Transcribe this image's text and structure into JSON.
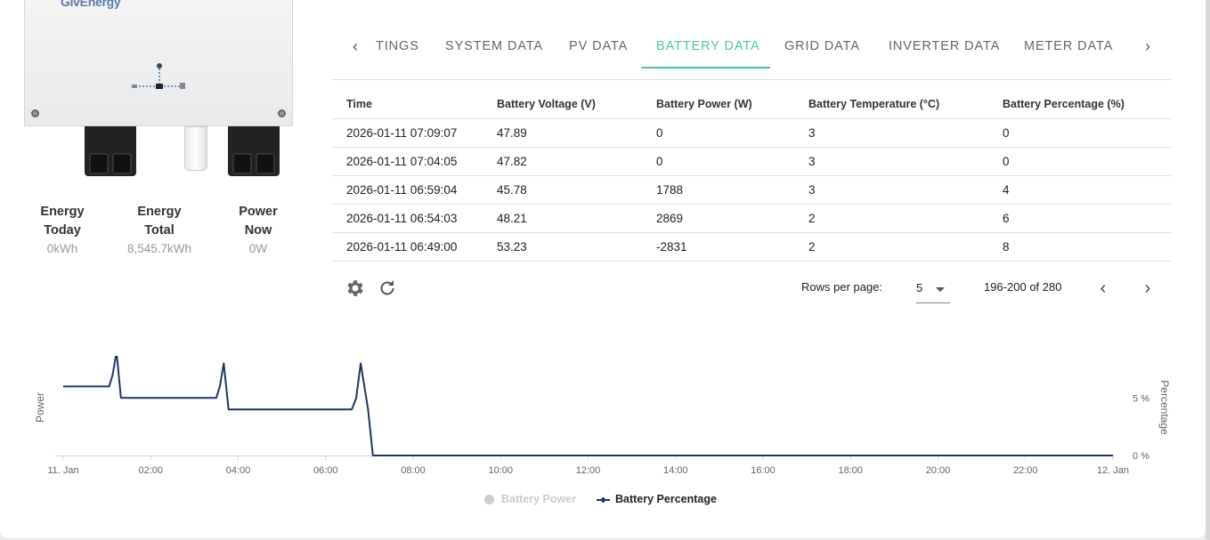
{
  "inverter": {
    "logo": "GivEnergy",
    "stats": [
      {
        "label_line1": "Energy",
        "label_line2": "Today",
        "value": "0kWh"
      },
      {
        "label_line1": "Energy",
        "label_line2": "Total",
        "value": "8,545.7kWh"
      },
      {
        "label_line1": "Power",
        "label_line2": "Now",
        "value": "0W"
      }
    ]
  },
  "tabs": {
    "items": [
      "TINGS",
      "SYSTEM DATA",
      "PV DATA",
      "BATTERY DATA",
      "GRID DATA",
      "INVERTER DATA",
      "METER DATA"
    ],
    "active": "BATTERY DATA",
    "accent": "#4fc6a2"
  },
  "table": {
    "headers": [
      "Time",
      "Battery Voltage (V)",
      "Battery Power (W)",
      "Battery Temperature (°C)",
      "Battery Percentage (%)"
    ],
    "rows": [
      [
        "2026-01-11 07:09:07",
        "47.89",
        "0",
        "3",
        "0"
      ],
      [
        "2026-01-11 07:04:05",
        "47.82",
        "0",
        "3",
        "0"
      ],
      [
        "2026-01-11 06:59:04",
        "45.78",
        "1788",
        "3",
        "4"
      ],
      [
        "2026-01-11 06:54:03",
        "48.21",
        "2869",
        "2",
        "6"
      ],
      [
        "2026-01-11 06:49:00",
        "53.23",
        "-2831",
        "2",
        "8"
      ]
    ],
    "footer": {
      "rows_per_page_label": "Rows per page:",
      "rows_per_page": "5",
      "range": "196-200 of 280"
    }
  },
  "chart_data": {
    "type": "line",
    "xlabels": [
      "11. Jan",
      "02:00",
      "04:00",
      "06:00",
      "08:00",
      "10:00",
      "12:00",
      "14:00",
      "16:00",
      "18:00",
      "20:00",
      "22:00",
      "12. Jan"
    ],
    "ylabel_left": "Power",
    "ylabel_right": "Percentage",
    "right_ticks": [
      "0 %",
      "5 %"
    ],
    "xlim_hours": [
      0,
      24
    ],
    "ylim_percent": [
      0,
      8.5
    ],
    "series": [
      {
        "name": "Battery Power",
        "visible": false,
        "color": "#cccccc",
        "values": []
      },
      {
        "name": "Battery Percentage",
        "visible": true,
        "color": "#1f3561",
        "points": [
          [
            0.0,
            6
          ],
          [
            1.05,
            6
          ],
          [
            1.13,
            7
          ],
          [
            1.22,
            9
          ],
          [
            1.32,
            5
          ],
          [
            3.5,
            5
          ],
          [
            3.58,
            6
          ],
          [
            3.67,
            8
          ],
          [
            3.78,
            4
          ],
          [
            6.6,
            4
          ],
          [
            6.7,
            5
          ],
          [
            6.8,
            8
          ],
          [
            6.97,
            4
          ],
          [
            7.08,
            0
          ],
          [
            24.0,
            0
          ]
        ]
      }
    ]
  }
}
